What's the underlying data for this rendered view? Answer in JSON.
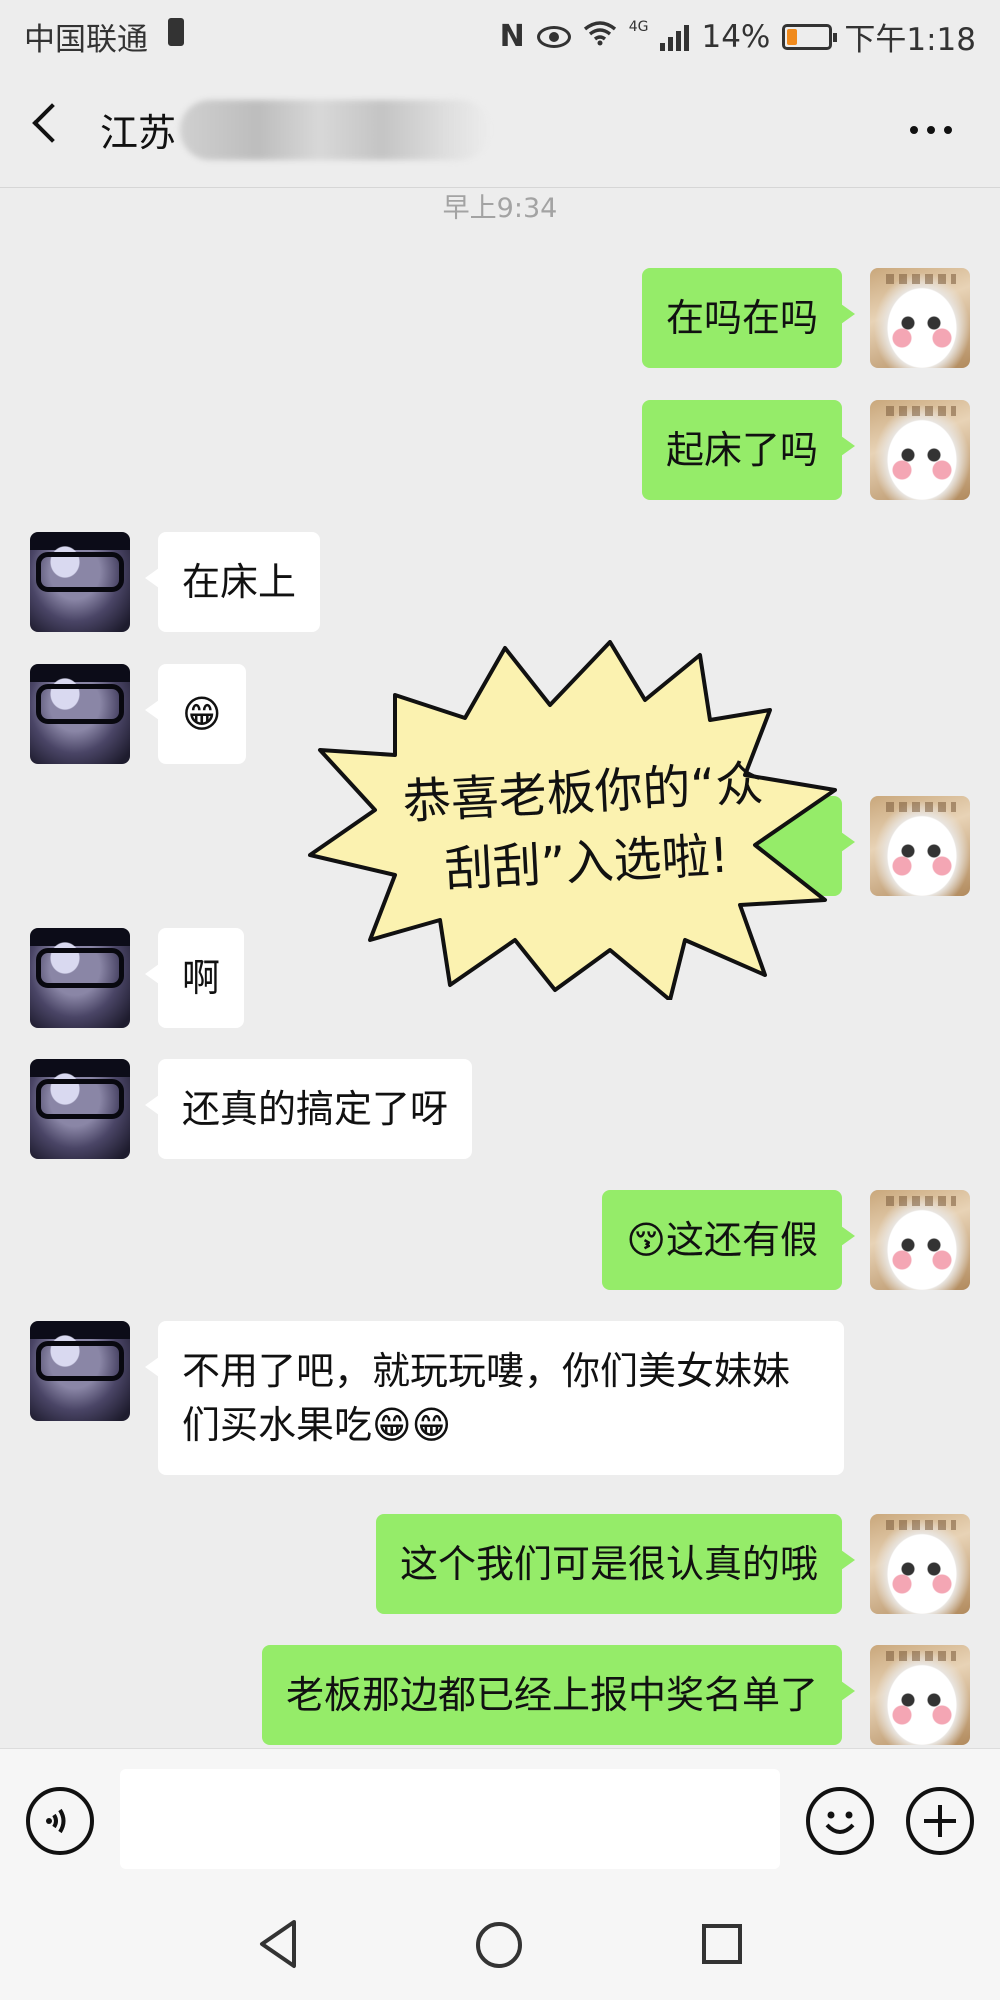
{
  "status_bar": {
    "carrier": "中国联通",
    "nfc": "N",
    "network": "4G",
    "battery": "14%",
    "time": "下午1:18"
  },
  "header": {
    "title": "江苏",
    "back_icon": "chevron-left",
    "more_icon": "ellipsis"
  },
  "timestamp": "早上9:34",
  "messages": [
    {
      "side": "out",
      "text": "在吗在吗"
    },
    {
      "side": "out",
      "text": "起床了吗"
    },
    {
      "side": "in",
      "text": "在床上"
    },
    {
      "side": "in",
      "text": "😁"
    },
    {
      "side": "in",
      "text": "啊"
    },
    {
      "side": "in",
      "text": "还真的搞定了呀"
    },
    {
      "side": "out",
      "text": "😚这还有假"
    },
    {
      "side": "in",
      "text": "不用了吧，就玩玩嘍，你们美女妹妹们买水果吃😁😁"
    },
    {
      "side": "out",
      "text": "这个我们可是很认真的哦"
    },
    {
      "side": "out",
      "text": "老板那边都已经上报中奖名单了"
    }
  ],
  "sticker": {
    "text": "恭喜老板你的“众刮刮”入选啦!"
  },
  "input_bar": {
    "voice_icon": "voice-icon",
    "emoji_icon": "emoji-icon",
    "plus_icon": "plus-icon",
    "input_value": ""
  },
  "colors": {
    "background": "#ededed",
    "outgoing_bubble": "#95ec69",
    "incoming_bubble": "#ffffff",
    "sticker_fill": "#fbf2b0"
  }
}
